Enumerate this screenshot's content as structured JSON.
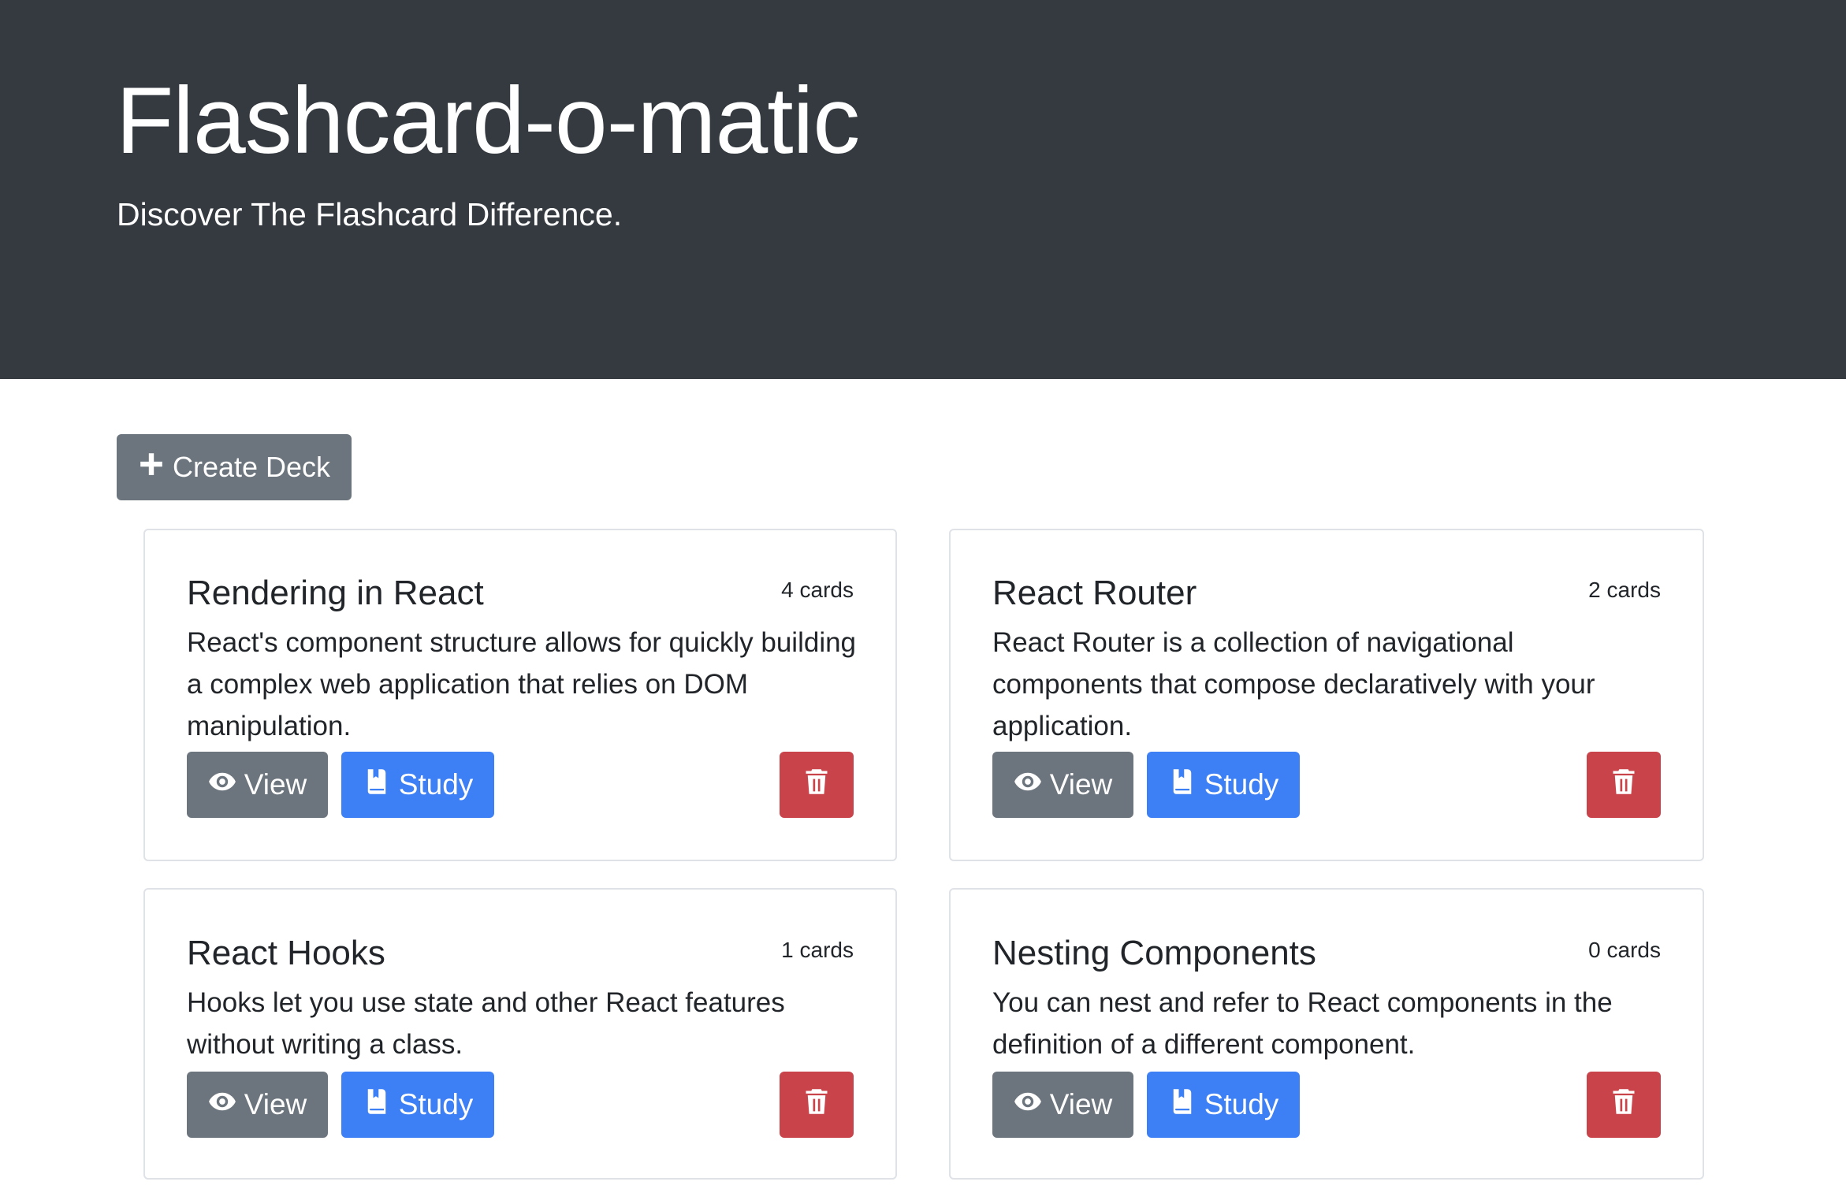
{
  "header": {
    "title": "Flashcard-o-matic",
    "subtitle": "Discover The Flashcard Difference."
  },
  "toolbar": {
    "create_label": "Create Deck",
    "create_icon": "plus-icon"
  },
  "buttons": {
    "view_label": "View",
    "study_label": "Study"
  },
  "decks": [
    {
      "name": "Rendering in React",
      "count": "4 cards",
      "description": "React's component structure allows for quickly building a complex web application that relies on DOM manipulation."
    },
    {
      "name": "React Router",
      "count": "2 cards",
      "description": "React Router is a collection of navigational components that compose declaratively with your application."
    },
    {
      "name": "React Hooks",
      "count": "1 cards",
      "description": "Hooks let you use state and other React features without writing a class."
    },
    {
      "name": "Nesting Components",
      "count": "0 cards",
      "description": "You can nest and refer to React components in the definition of a different component."
    }
  ],
  "colors": {
    "header_bg": "#343a40",
    "secondary": "#6c757d",
    "primary": "#3d7ff5",
    "danger": "#c9434a"
  }
}
